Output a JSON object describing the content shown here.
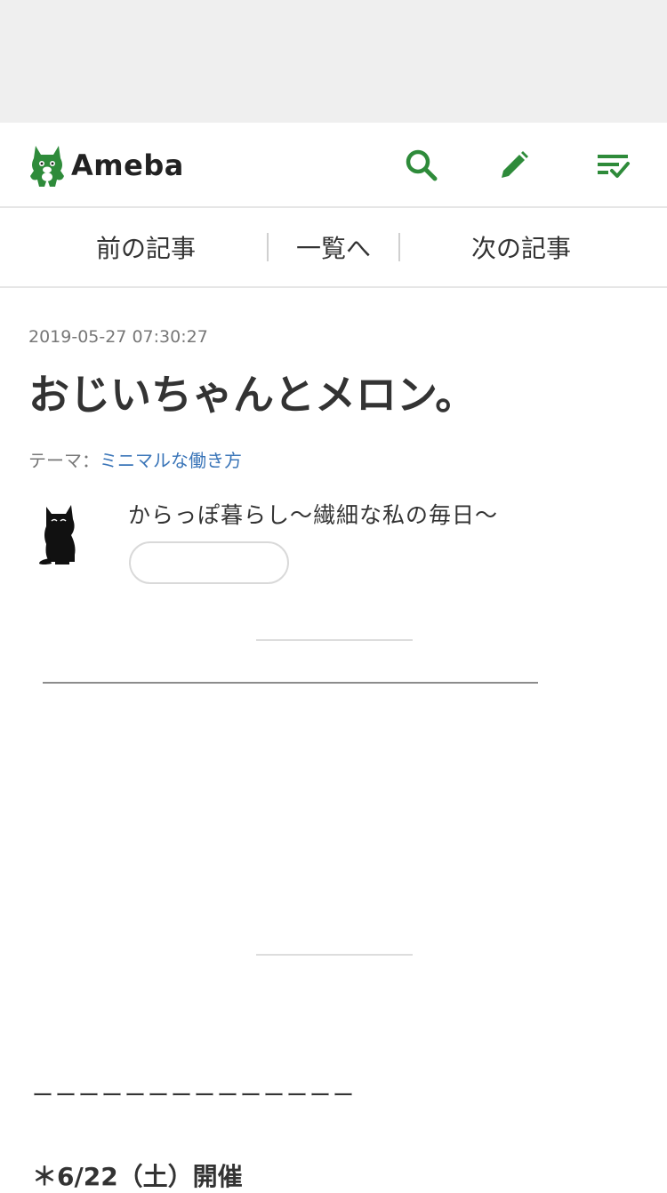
{
  "header": {
    "logo_text": "Ameba",
    "icons": [
      "search-icon",
      "pencil-icon",
      "list-check-icon"
    ],
    "accent_color": "#2e8b3a"
  },
  "nav": {
    "prev": "前の記事",
    "list": "一覧へ",
    "next": "次の記事"
  },
  "article": {
    "date": "2019-05-27 07:30:27",
    "title": "おじいちゃんとメロン。",
    "theme_label": "テーマ：",
    "theme_value": "ミニマルな働き方",
    "blog_name": "からっぽ暮らし〜繊細な私の毎日〜",
    "follow_button_label": "",
    "dashes": "ーーーーーーーーーーーーーー",
    "event_line": "＊6/22（土）開催"
  }
}
